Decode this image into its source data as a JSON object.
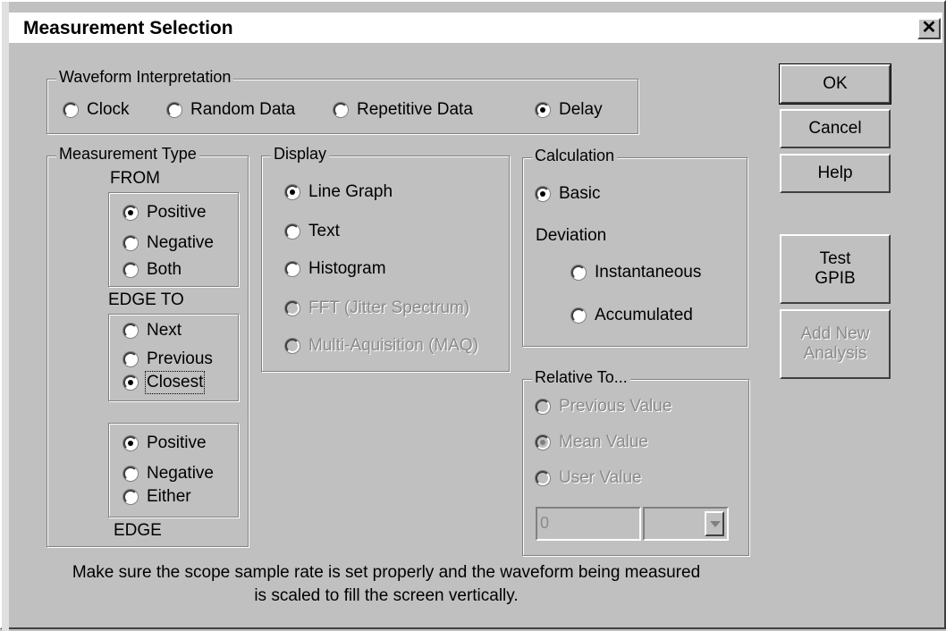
{
  "window": {
    "title": "Measurement Selection"
  },
  "waveform": {
    "legend": "Waveform Interpretation",
    "options": [
      "Clock",
      "Random Data",
      "Repetitive Data",
      "Delay"
    ],
    "selected": "Delay"
  },
  "measurement_type": {
    "legend": "Measurement Type",
    "from_label": "FROM",
    "from_edge": [
      "Positive",
      "Negative",
      "Both"
    ],
    "edge_to_label": "EDGE TO",
    "edge_to": [
      "Next",
      "Previous",
      "Closest"
    ],
    "to_edge": [
      "Positive",
      "Negative",
      "Either"
    ],
    "edge_label": "EDGE"
  },
  "display": {
    "legend": "Display",
    "options": [
      "Line Graph",
      "Text",
      "Histogram",
      "FFT (Jitter Spectrum)",
      "Multi-Aquisition (MAQ)"
    ]
  },
  "calculation": {
    "legend": "Calculation",
    "basic": "Basic",
    "deviation_label": "Deviation",
    "instantaneous": "Instantaneous",
    "accumulated": "Accumulated"
  },
  "relative_to": {
    "legend": "Relative To...",
    "options": [
      "Previous Value",
      "Mean Value",
      "User Value"
    ],
    "user_value": "0"
  },
  "buttons": {
    "ok": "OK",
    "cancel": "Cancel",
    "help": "Help",
    "test_gpib_line1": "Test",
    "test_gpib_line2": "GPIB",
    "add_analysis_line1": "Add New",
    "add_analysis_line2": "Analysis"
  },
  "note": {
    "line1": "Make sure the scope sample rate is set properly and the waveform being measured",
    "line2": "is scaled to fill the screen vertically."
  }
}
